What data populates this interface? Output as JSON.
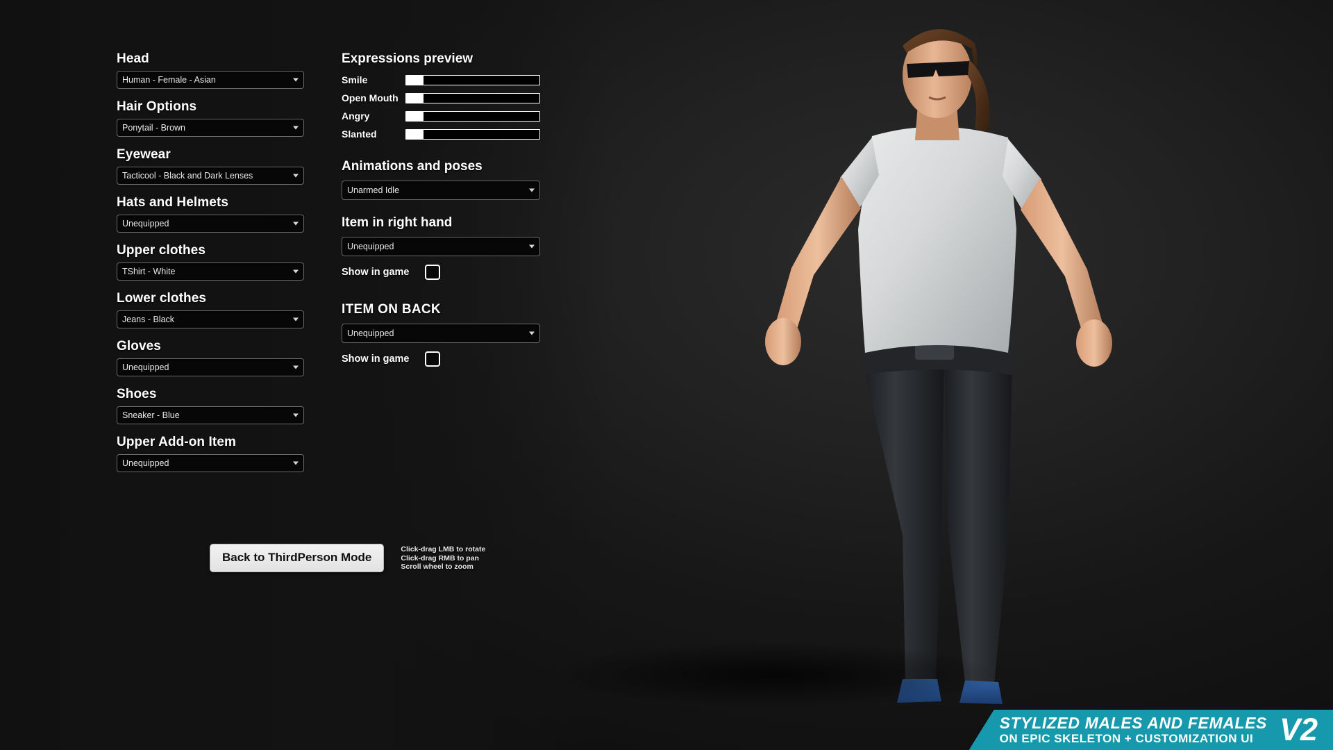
{
  "appearance": {
    "accent_color": "#1799ad",
    "background_color": "#141414",
    "panel_text_color": "#ffffff",
    "combo_border_color": "#6c6c6c"
  },
  "left_panel": {
    "groups": [
      {
        "label": "Head",
        "value": "Human - Female - Asian",
        "icon": "chevron-down-icon"
      },
      {
        "label": "Hair Options",
        "value": "Ponytail - Brown",
        "icon": "chevron-down-icon"
      },
      {
        "label": "Eyewear",
        "value": "Tacticool - Black and Dark Lenses",
        "icon": "chevron-down-icon"
      },
      {
        "label": "Hats and Helmets",
        "value": "Unequipped",
        "icon": "chevron-down-icon"
      },
      {
        "label": "Upper clothes",
        "value": "TShirt - White",
        "icon": "chevron-down-icon"
      },
      {
        "label": "Lower clothes",
        "value": "Jeans - Black",
        "icon": "chevron-down-icon"
      },
      {
        "label": "Gloves",
        "value": "Unequipped",
        "icon": "chevron-down-icon"
      },
      {
        "label": "Shoes",
        "value": "Sneaker - Blue",
        "icon": "chevron-down-icon"
      },
      {
        "label": "Upper Add-on Item",
        "value": "Unequipped",
        "icon": "chevron-down-icon"
      }
    ]
  },
  "right_panel": {
    "expressions": {
      "title": "Expressions preview",
      "sliders": [
        {
          "label": "Smile",
          "value": 0,
          "min": 0,
          "max": 100
        },
        {
          "label": "Open Mouth",
          "value": 0,
          "min": 0,
          "max": 100
        },
        {
          "label": "Angry",
          "value": 0,
          "min": 0,
          "max": 100
        },
        {
          "label": "Slanted",
          "value": 0,
          "min": 0,
          "max": 100
        }
      ]
    },
    "animations": {
      "title": "Animations and poses",
      "value": "Unarmed Idle",
      "icon": "chevron-down-icon"
    },
    "right_hand": {
      "title": "Item in right hand",
      "value": "Unequipped",
      "icon": "chevron-down-icon",
      "show_in_game_label": "Show in game",
      "show_in_game_checked": false
    },
    "item_on_back": {
      "title": "ITEM ON BACK",
      "value": "Unequipped",
      "icon": "chevron-down-icon",
      "show_in_game_label": "Show in game",
      "show_in_game_checked": false
    }
  },
  "bottom": {
    "back_button_label": "Back to ThirdPerson Mode",
    "hints": [
      "Click-drag LMB to rotate",
      "Click-drag RMB to pan",
      "Scroll wheel to zoom"
    ]
  },
  "banner": {
    "line1": "STYLIZED MALES AND FEMALES",
    "line2": "ON EPIC SKELETON + CUSTOMIZATION UI",
    "version": "V2"
  }
}
